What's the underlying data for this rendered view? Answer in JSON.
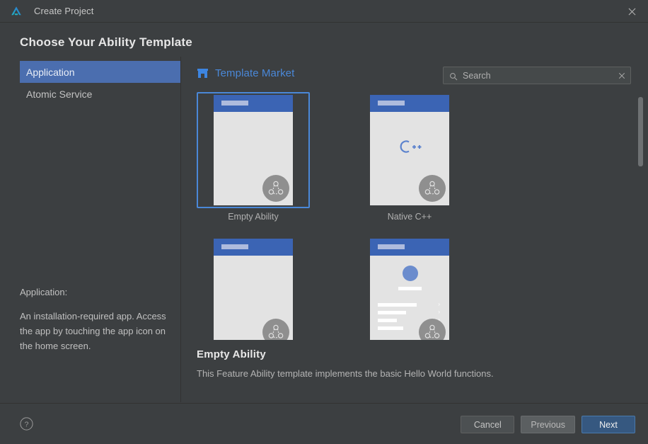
{
  "window": {
    "title": "Create Project",
    "logo_icon": "deveco-logo-icon",
    "close_icon": "close-icon"
  },
  "page": {
    "heading": "Choose Your Ability Template"
  },
  "sidebar": {
    "items": [
      {
        "label": "Application",
        "selected": true
      },
      {
        "label": "Atomic Service",
        "selected": false
      }
    ],
    "description": {
      "heading": "Application:",
      "body": "An installation-required app. Access the app by touching the app icon on the home screen."
    }
  },
  "market": {
    "icon": "store-icon",
    "label": "Template Market"
  },
  "search": {
    "icon": "search-icon",
    "placeholder": "Search",
    "value": "",
    "clear_icon": "close-icon"
  },
  "templates": [
    {
      "label": "Empty Ability",
      "kind": "blank",
      "selected": true,
      "badge_icon": "distributed-ability-icon"
    },
    {
      "label": "Native C++",
      "kind": "cpp",
      "selected": false,
      "badge_icon": "distributed-ability-icon",
      "glyph": "C++"
    },
    {
      "label": "",
      "kind": "blank",
      "selected": false,
      "badge_icon": "distributed-ability-icon"
    },
    {
      "label": "",
      "kind": "profile",
      "selected": false,
      "badge_icon": "distributed-ability-icon"
    }
  ],
  "detail": {
    "title": "Empty Ability",
    "description": "This Feature Ability template implements the basic Hello World functions."
  },
  "footer": {
    "help_icon": "help-icon",
    "cancel_label": "Cancel",
    "previous_label": "Previous",
    "next_label": "Next"
  },
  "colors": {
    "background": "#3c3f41",
    "accent_blue": "#4a88d8",
    "selection_blue": "#4b6eaf",
    "primary_button": "#365880",
    "phone_bar_blue": "#3b64b4"
  }
}
